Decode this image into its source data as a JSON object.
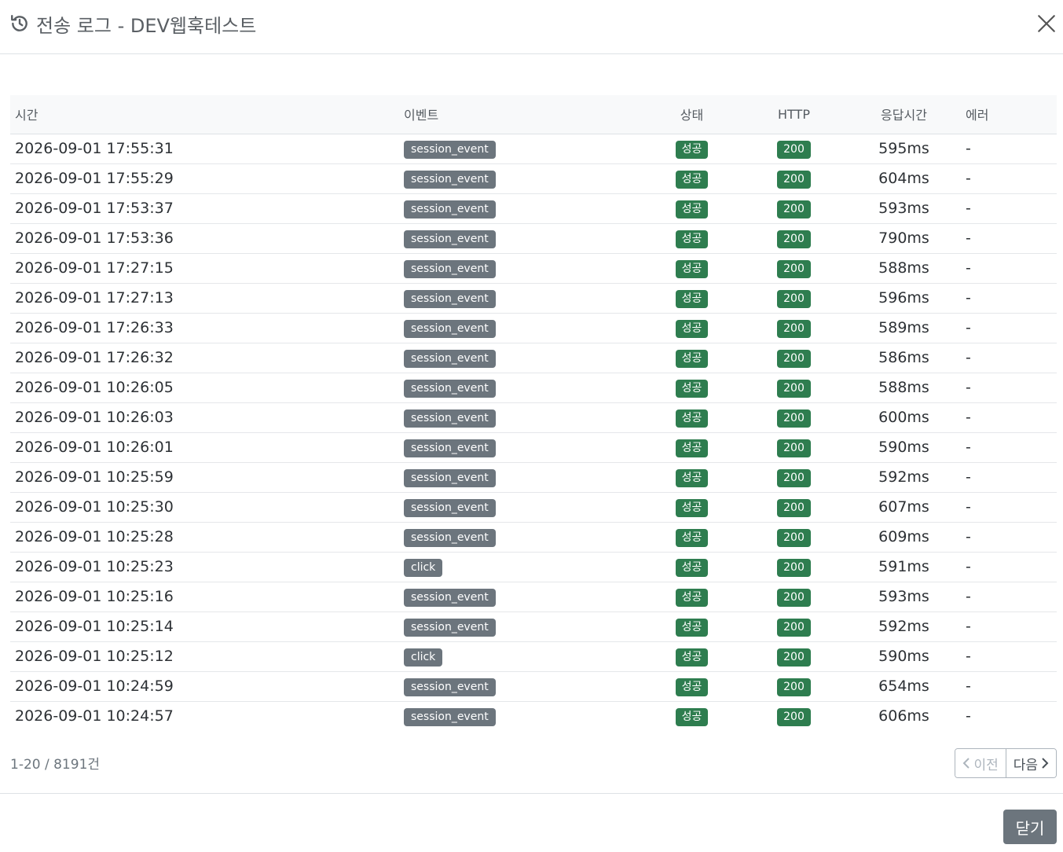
{
  "modal": {
    "title": "전송 로그 - DEV웹훅테스트",
    "close_icon": "close-icon",
    "history_icon": "history-icon"
  },
  "table": {
    "columns": [
      "시간",
      "이벤트",
      "상태",
      "HTTP",
      "응답시간",
      "에러"
    ],
    "rows": [
      {
        "time": "2026-09-01 17:55:31",
        "event": "session_event",
        "status": "성공",
        "http": "200",
        "response": "595ms",
        "error": "-"
      },
      {
        "time": "2026-09-01 17:55:29",
        "event": "session_event",
        "status": "성공",
        "http": "200",
        "response": "604ms",
        "error": "-"
      },
      {
        "time": "2026-09-01 17:53:37",
        "event": "session_event",
        "status": "성공",
        "http": "200",
        "response": "593ms",
        "error": "-"
      },
      {
        "time": "2026-09-01 17:53:36",
        "event": "session_event",
        "status": "성공",
        "http": "200",
        "response": "790ms",
        "error": "-"
      },
      {
        "time": "2026-09-01 17:27:15",
        "event": "session_event",
        "status": "성공",
        "http": "200",
        "response": "588ms",
        "error": "-"
      },
      {
        "time": "2026-09-01 17:27:13",
        "event": "session_event",
        "status": "성공",
        "http": "200",
        "response": "596ms",
        "error": "-"
      },
      {
        "time": "2026-09-01 17:26:33",
        "event": "session_event",
        "status": "성공",
        "http": "200",
        "response": "589ms",
        "error": "-"
      },
      {
        "time": "2026-09-01 17:26:32",
        "event": "session_event",
        "status": "성공",
        "http": "200",
        "response": "586ms",
        "error": "-"
      },
      {
        "time": "2026-09-01 10:26:05",
        "event": "session_event",
        "status": "성공",
        "http": "200",
        "response": "588ms",
        "error": "-"
      },
      {
        "time": "2026-09-01 10:26:03",
        "event": "session_event",
        "status": "성공",
        "http": "200",
        "response": "600ms",
        "error": "-"
      },
      {
        "time": "2026-09-01 10:26:01",
        "event": "session_event",
        "status": "성공",
        "http": "200",
        "response": "590ms",
        "error": "-"
      },
      {
        "time": "2026-09-01 10:25:59",
        "event": "session_event",
        "status": "성공",
        "http": "200",
        "response": "592ms",
        "error": "-"
      },
      {
        "time": "2026-09-01 10:25:30",
        "event": "session_event",
        "status": "성공",
        "http": "200",
        "response": "607ms",
        "error": "-"
      },
      {
        "time": "2026-09-01 10:25:28",
        "event": "session_event",
        "status": "성공",
        "http": "200",
        "response": "609ms",
        "error": "-"
      },
      {
        "time": "2026-09-01 10:25:23",
        "event": "click",
        "status": "성공",
        "http": "200",
        "response": "591ms",
        "error": "-"
      },
      {
        "time": "2026-09-01 10:25:16",
        "event": "session_event",
        "status": "성공",
        "http": "200",
        "response": "593ms",
        "error": "-"
      },
      {
        "time": "2026-09-01 10:25:14",
        "event": "session_event",
        "status": "성공",
        "http": "200",
        "response": "592ms",
        "error": "-"
      },
      {
        "time": "2026-09-01 10:25:12",
        "event": "click",
        "status": "성공",
        "http": "200",
        "response": "590ms",
        "error": "-"
      },
      {
        "time": "2026-09-01 10:24:59",
        "event": "session_event",
        "status": "성공",
        "http": "200",
        "response": "654ms",
        "error": "-"
      },
      {
        "time": "2026-09-01 10:24:57",
        "event": "session_event",
        "status": "성공",
        "http": "200",
        "response": "606ms",
        "error": "-"
      }
    ]
  },
  "pagination": {
    "summary": "1-20 / 8191건",
    "prev_label": "이전",
    "next_label": "다음"
  },
  "footer": {
    "close_label": "닫기"
  },
  "colors": {
    "event_badge": "#6c757d",
    "success_badge": "#2e7d4f"
  }
}
